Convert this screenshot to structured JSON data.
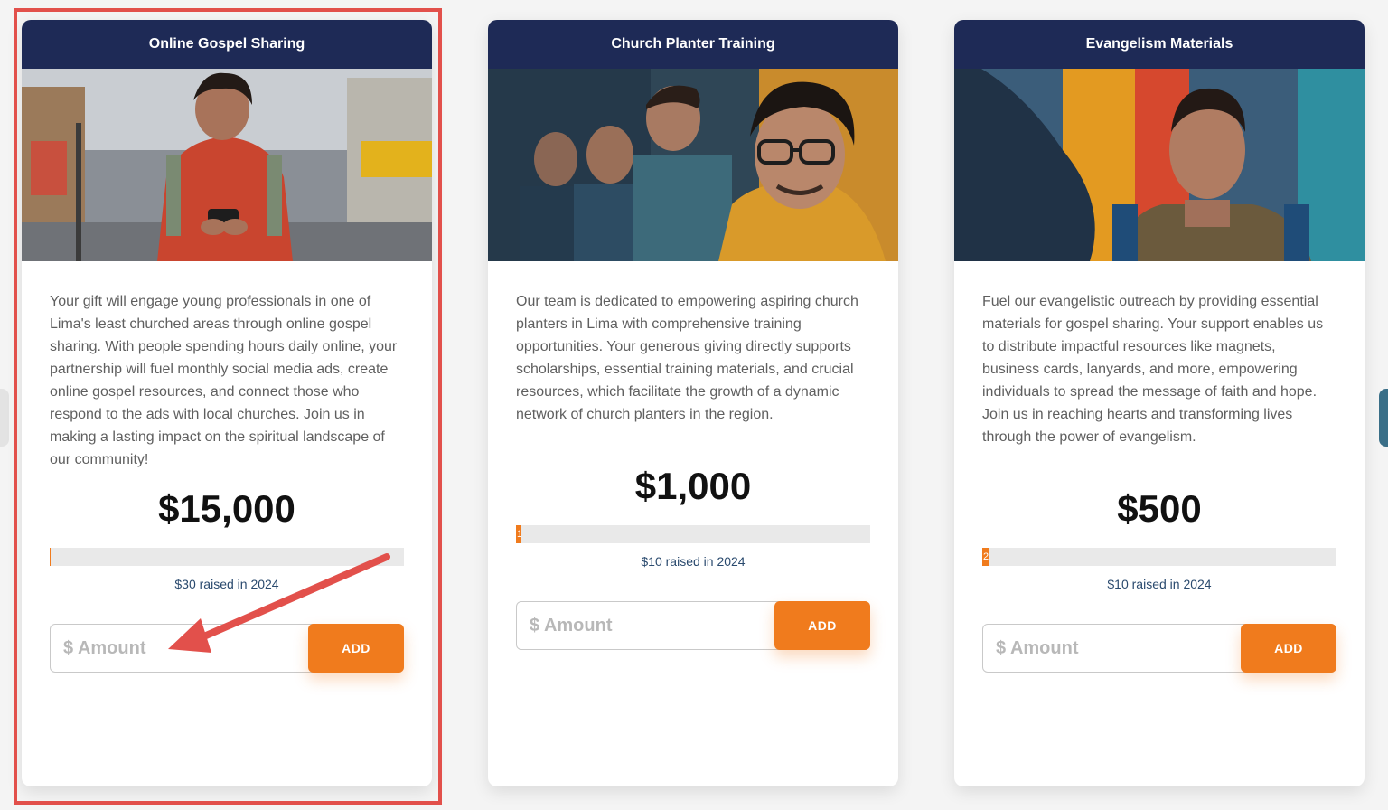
{
  "cards": [
    {
      "title": "Online Gospel Sharing",
      "description": "Your gift will engage young professionals in one of Lima's least churched areas through online gospel sharing. With people spending hours daily online, your partnership will fuel monthly social media ads, create online gospel resources, and connect those who respond to the ads with local churches. Join us in making a lasting impact on the spiritual landscape of our community!",
      "goal": "$15,000",
      "progress_fraction": 0.002,
      "progress_label": "",
      "raised": "$30 raised in 2024",
      "amount_placeholder": "$ Amount",
      "add_label": "ADD",
      "highlighted": true
    },
    {
      "title": "Church Planter Training",
      "description": "Our team is dedicated to empowering aspiring church planters in Lima with comprehensive training opportunities. Your generous giving directly supports scholarships, essential training materials, and crucial resources, which facilitate the growth of a dynamic network of church planters in the region.",
      "goal": "$1,000",
      "progress_fraction": 0.01,
      "progress_label": "1",
      "raised": "$10 raised in 2024",
      "amount_placeholder": "$ Amount",
      "add_label": "ADD",
      "highlighted": false
    },
    {
      "title": "Evangelism Materials",
      "description": "Fuel our evangelistic outreach by providing essential materials for gospel sharing. Your support enables us to distribute impactful resources like magnets, business cards, lanyards, and more, empowering individuals to spread the message of faith and hope. Join us in reaching hearts and transforming lives through the power of evangelism.",
      "goal": "$500",
      "progress_fraction": 0.02,
      "progress_label": "2",
      "raised": "$10 raised in 2024",
      "amount_placeholder": "$ Amount",
      "add_label": "ADD",
      "highlighted": false
    }
  ],
  "colors": {
    "header": "#1e2a56",
    "accent": "#f07b1d",
    "annotation": "#e2504b",
    "raised_text": "#2a4a6e"
  }
}
